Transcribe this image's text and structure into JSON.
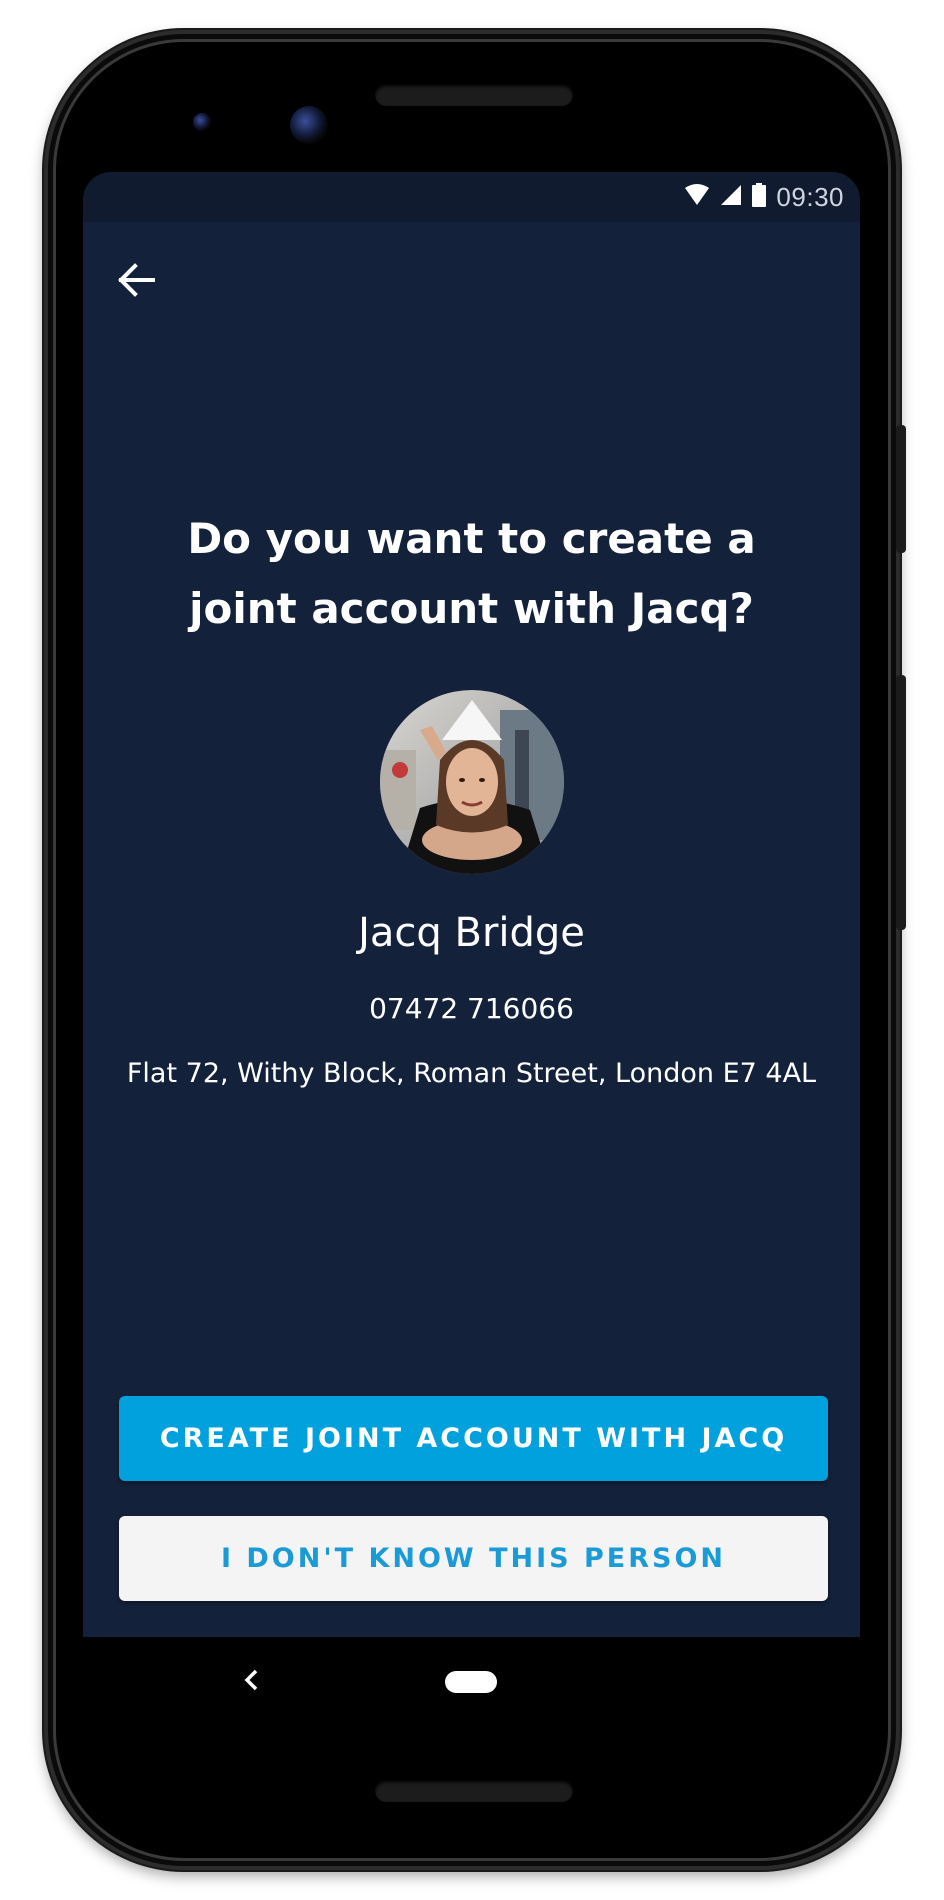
{
  "status_bar": {
    "time": "09:30",
    "icons": [
      "wifi-icon",
      "cellular-signal-icon",
      "battery-icon"
    ]
  },
  "header": {
    "back_icon": "arrow-left-icon"
  },
  "main": {
    "title_line1": "Do you want to create a",
    "title_line2": "joint account with Jacq?",
    "avatar": "profile-photo",
    "name": "Jacq Bridge",
    "phone": "07472 716066",
    "address": "Flat 72, Withy Block, Roman Street, London E7 4AL"
  },
  "actions": {
    "primary_label": "CREATE JOINT ACCOUNT WITH JACQ",
    "secondary_label": "I DON'T KNOW THIS PERSON"
  },
  "colors": {
    "background": "#14213a",
    "primary_button": "#00a1dc",
    "secondary_button": "#f4f4f5",
    "secondary_text": "#1a9ad6"
  },
  "navigation_bar": {
    "back_icon": "chevron-left-icon",
    "home_icon": "home-pill-icon"
  }
}
